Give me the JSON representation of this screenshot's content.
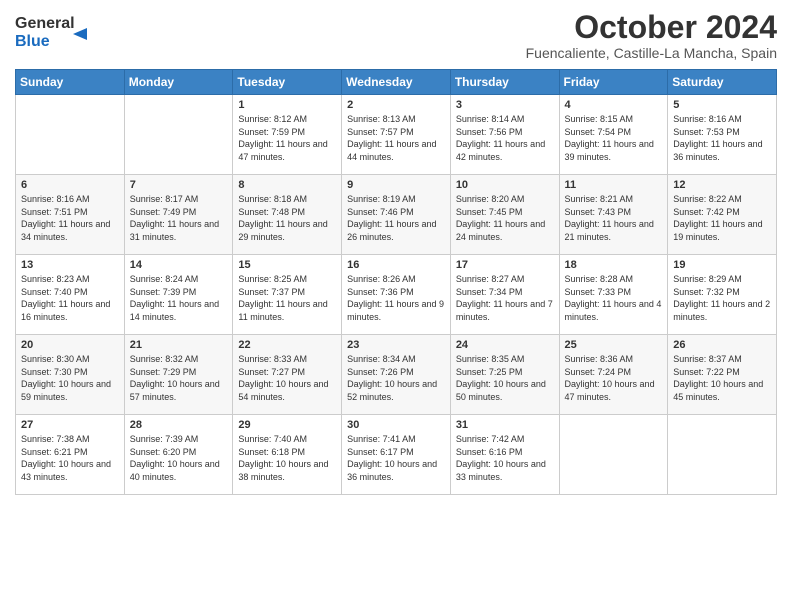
{
  "header": {
    "logo_line1": "General",
    "logo_line2": "Blue",
    "month": "October 2024",
    "location": "Fuencaliente, Castille-La Mancha, Spain"
  },
  "weekdays": [
    "Sunday",
    "Monday",
    "Tuesday",
    "Wednesday",
    "Thursday",
    "Friday",
    "Saturday"
  ],
  "weeks": [
    [
      {
        "day": "",
        "info": ""
      },
      {
        "day": "",
        "info": ""
      },
      {
        "day": "1",
        "info": "Sunrise: 8:12 AM\nSunset: 7:59 PM\nDaylight: 11 hours and 47 minutes."
      },
      {
        "day": "2",
        "info": "Sunrise: 8:13 AM\nSunset: 7:57 PM\nDaylight: 11 hours and 44 minutes."
      },
      {
        "day": "3",
        "info": "Sunrise: 8:14 AM\nSunset: 7:56 PM\nDaylight: 11 hours and 42 minutes."
      },
      {
        "day": "4",
        "info": "Sunrise: 8:15 AM\nSunset: 7:54 PM\nDaylight: 11 hours and 39 minutes."
      },
      {
        "day": "5",
        "info": "Sunrise: 8:16 AM\nSunset: 7:53 PM\nDaylight: 11 hours and 36 minutes."
      }
    ],
    [
      {
        "day": "6",
        "info": "Sunrise: 8:16 AM\nSunset: 7:51 PM\nDaylight: 11 hours and 34 minutes."
      },
      {
        "day": "7",
        "info": "Sunrise: 8:17 AM\nSunset: 7:49 PM\nDaylight: 11 hours and 31 minutes."
      },
      {
        "day": "8",
        "info": "Sunrise: 8:18 AM\nSunset: 7:48 PM\nDaylight: 11 hours and 29 minutes."
      },
      {
        "day": "9",
        "info": "Sunrise: 8:19 AM\nSunset: 7:46 PM\nDaylight: 11 hours and 26 minutes."
      },
      {
        "day": "10",
        "info": "Sunrise: 8:20 AM\nSunset: 7:45 PM\nDaylight: 11 hours and 24 minutes."
      },
      {
        "day": "11",
        "info": "Sunrise: 8:21 AM\nSunset: 7:43 PM\nDaylight: 11 hours and 21 minutes."
      },
      {
        "day": "12",
        "info": "Sunrise: 8:22 AM\nSunset: 7:42 PM\nDaylight: 11 hours and 19 minutes."
      }
    ],
    [
      {
        "day": "13",
        "info": "Sunrise: 8:23 AM\nSunset: 7:40 PM\nDaylight: 11 hours and 16 minutes."
      },
      {
        "day": "14",
        "info": "Sunrise: 8:24 AM\nSunset: 7:39 PM\nDaylight: 11 hours and 14 minutes."
      },
      {
        "day": "15",
        "info": "Sunrise: 8:25 AM\nSunset: 7:37 PM\nDaylight: 11 hours and 11 minutes."
      },
      {
        "day": "16",
        "info": "Sunrise: 8:26 AM\nSunset: 7:36 PM\nDaylight: 11 hours and 9 minutes."
      },
      {
        "day": "17",
        "info": "Sunrise: 8:27 AM\nSunset: 7:34 PM\nDaylight: 11 hours and 7 minutes."
      },
      {
        "day": "18",
        "info": "Sunrise: 8:28 AM\nSunset: 7:33 PM\nDaylight: 11 hours and 4 minutes."
      },
      {
        "day": "19",
        "info": "Sunrise: 8:29 AM\nSunset: 7:32 PM\nDaylight: 11 hours and 2 minutes."
      }
    ],
    [
      {
        "day": "20",
        "info": "Sunrise: 8:30 AM\nSunset: 7:30 PM\nDaylight: 10 hours and 59 minutes."
      },
      {
        "day": "21",
        "info": "Sunrise: 8:32 AM\nSunset: 7:29 PM\nDaylight: 10 hours and 57 minutes."
      },
      {
        "day": "22",
        "info": "Sunrise: 8:33 AM\nSunset: 7:27 PM\nDaylight: 10 hours and 54 minutes."
      },
      {
        "day": "23",
        "info": "Sunrise: 8:34 AM\nSunset: 7:26 PM\nDaylight: 10 hours and 52 minutes."
      },
      {
        "day": "24",
        "info": "Sunrise: 8:35 AM\nSunset: 7:25 PM\nDaylight: 10 hours and 50 minutes."
      },
      {
        "day": "25",
        "info": "Sunrise: 8:36 AM\nSunset: 7:24 PM\nDaylight: 10 hours and 47 minutes."
      },
      {
        "day": "26",
        "info": "Sunrise: 8:37 AM\nSunset: 7:22 PM\nDaylight: 10 hours and 45 minutes."
      }
    ],
    [
      {
        "day": "27",
        "info": "Sunrise: 7:38 AM\nSunset: 6:21 PM\nDaylight: 10 hours and 43 minutes."
      },
      {
        "day": "28",
        "info": "Sunrise: 7:39 AM\nSunset: 6:20 PM\nDaylight: 10 hours and 40 minutes."
      },
      {
        "day": "29",
        "info": "Sunrise: 7:40 AM\nSunset: 6:18 PM\nDaylight: 10 hours and 38 minutes."
      },
      {
        "day": "30",
        "info": "Sunrise: 7:41 AM\nSunset: 6:17 PM\nDaylight: 10 hours and 36 minutes."
      },
      {
        "day": "31",
        "info": "Sunrise: 7:42 AM\nSunset: 6:16 PM\nDaylight: 10 hours and 33 minutes."
      },
      {
        "day": "",
        "info": ""
      },
      {
        "day": "",
        "info": ""
      }
    ]
  ]
}
